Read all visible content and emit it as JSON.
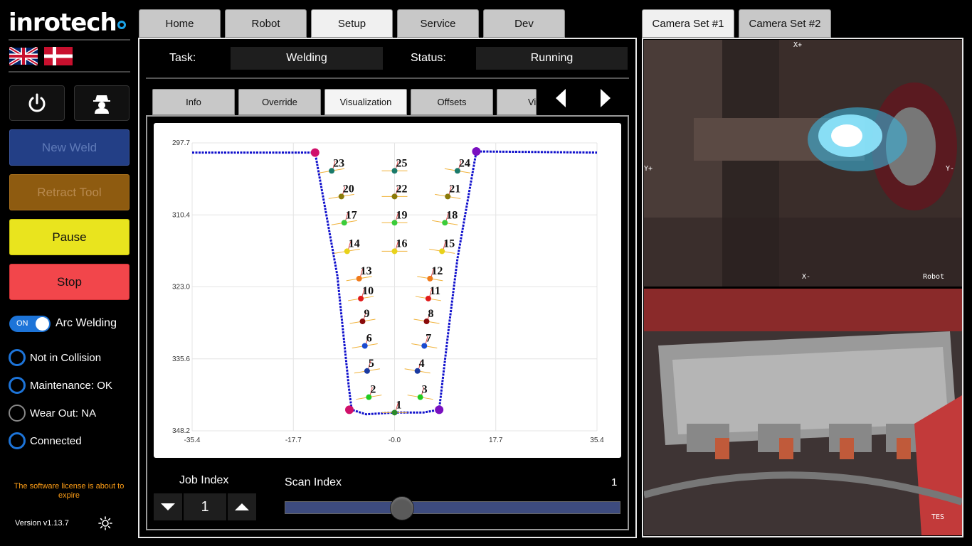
{
  "brand": {
    "name": "inrotech"
  },
  "sidebar": {
    "buttons": {
      "new_weld": "New Weld",
      "retract_tool": "Retract Tool",
      "pause": "Pause",
      "stop": "Stop"
    },
    "arc_toggle": {
      "state": "ON",
      "label": "Arc Welding"
    },
    "statuses": [
      {
        "label": "Not in Collision",
        "indicator": "blue-ring"
      },
      {
        "label": "Maintenance: OK",
        "indicator": "blue-ring"
      },
      {
        "label": "Wear Out: NA",
        "indicator": "grey-ring"
      },
      {
        "label": "Connected",
        "indicator": "blue-ring"
      }
    ],
    "license_notice": "The software license is about to expire",
    "version": "Version v1.13.7",
    "icons": [
      "uk-flag-icon",
      "dk-flag-icon",
      "power-icon",
      "spy-icon",
      "sun-icon"
    ]
  },
  "main_tabs": [
    "Home",
    "Robot",
    "Setup",
    "Service",
    "Dev"
  ],
  "main_active_tab": "Setup",
  "task": {
    "label": "Task:",
    "value": "Welding"
  },
  "status": {
    "label": "Status:",
    "value": "Running"
  },
  "sub_tabs": [
    "Info",
    "Override",
    "Visualization",
    "Offsets",
    "Vi"
  ],
  "sub_active_tab": "Visualization",
  "job_index": {
    "label": "Job Index",
    "value": "1"
  },
  "scan_index": {
    "label": "Scan Index",
    "value": "1",
    "slider_fraction": 0.35
  },
  "camera_tabs": [
    "Camera Set #1",
    "Camera Set #2"
  ],
  "camera_active_tab": "Camera Set #1",
  "camera_overlays": {
    "top": {
      "x_plus": "X+",
      "x_minus": "X-",
      "y_plus": "Y+",
      "y_minus": "Y-",
      "robot": "Robot"
    },
    "bottom": {
      "tes": "TES"
    }
  },
  "colors": {
    "accent_blue": "#1d74d8",
    "pause_yellow": "#e9e41e",
    "stop_red": "#f2464b",
    "retract_orange": "#8e5b10",
    "newweld_blue": "#233f86",
    "license_orange": "#ff9e16"
  },
  "chart_data": {
    "type": "scatter",
    "x_ticks": [
      "-35.4",
      "-17.7",
      "-0.0",
      "17.7",
      "35.4"
    ],
    "y_ticks": [
      "297.7",
      "310.4",
      "323.0",
      "335.6",
      "348.2"
    ],
    "xlim": [
      -35.4,
      35.4
    ],
    "ylim": [
      297.7,
      348.2
    ],
    "y_inverted": true,
    "grid": true,
    "profile": [
      [
        -35.4,
        299.4
      ],
      [
        -13.9,
        299.4
      ],
      [
        -10.0,
        321.0
      ],
      [
        -8.0,
        340.5
      ],
      [
        -7.5,
        344.5
      ],
      [
        -5.0,
        345.3
      ],
      [
        0.0,
        345.0
      ],
      [
        5.0,
        345.0
      ],
      [
        7.8,
        344.5
      ],
      [
        9.5,
        330.0
      ],
      [
        11.0,
        318.0
      ],
      [
        14.3,
        299.2
      ],
      [
        35.4,
        299.4
      ]
    ],
    "corner_markers": [
      {
        "x": -13.9,
        "y": 299.4,
        "color": "#d0106a"
      },
      {
        "x": 14.3,
        "y": 299.2,
        "color": "#7a10c0"
      },
      {
        "x": -7.9,
        "y": 344.5,
        "color": "#d0106a"
      },
      {
        "x": 7.8,
        "y": 344.5,
        "color": "#7a10c0"
      }
    ],
    "points": [
      {
        "label": "1",
        "x": 0.0,
        "y": 345.0,
        "color": "#2a8a2a"
      },
      {
        "label": "2",
        "x": -4.5,
        "y": 342.3,
        "color": "#20cc20"
      },
      {
        "label": "3",
        "x": 4.5,
        "y": 342.3,
        "color": "#20cc20"
      },
      {
        "label": "4",
        "x": 4.0,
        "y": 337.7,
        "color": "#1a3aa0"
      },
      {
        "label": "5",
        "x": -4.8,
        "y": 337.7,
        "color": "#1a3aa0"
      },
      {
        "label": "6",
        "x": -5.2,
        "y": 333.3,
        "color": "#1a4ad0"
      },
      {
        "label": "7",
        "x": 5.2,
        "y": 333.3,
        "color": "#1a4ad0"
      },
      {
        "label": "8",
        "x": 5.6,
        "y": 329.0,
        "color": "#8a0a0a"
      },
      {
        "label": "9",
        "x": -5.6,
        "y": 329.0,
        "color": "#8a0a0a"
      },
      {
        "label": "10",
        "x": -5.9,
        "y": 325.0,
        "color": "#e01a1a"
      },
      {
        "label": "11",
        "x": 5.9,
        "y": 325.0,
        "color": "#e01a1a"
      },
      {
        "label": "12",
        "x": 6.2,
        "y": 321.5,
        "color": "#f07a1a"
      },
      {
        "label": "13",
        "x": -6.2,
        "y": 321.5,
        "color": "#f07a1a"
      },
      {
        "label": "14",
        "x": -8.3,
        "y": 316.7,
        "color": "#e8d21a"
      },
      {
        "label": "15",
        "x": 8.3,
        "y": 316.7,
        "color": "#e8d21a"
      },
      {
        "label": "16",
        "x": 0.0,
        "y": 316.7,
        "color": "#e8d21a"
      },
      {
        "label": "17",
        "x": -8.8,
        "y": 311.7,
        "color": "#3acc3a"
      },
      {
        "label": "18",
        "x": 8.8,
        "y": 311.7,
        "color": "#3acc3a"
      },
      {
        "label": "19",
        "x": 0.0,
        "y": 311.7,
        "color": "#3acc3a"
      },
      {
        "label": "20",
        "x": -9.3,
        "y": 307.1,
        "color": "#8a7a0a"
      },
      {
        "label": "21",
        "x": 9.3,
        "y": 307.1,
        "color": "#8a7a0a"
      },
      {
        "label": "22",
        "x": 0.0,
        "y": 307.1,
        "color": "#8a7a0a"
      },
      {
        "label": "23",
        "x": -11.0,
        "y": 302.6,
        "color": "#1a7a6a"
      },
      {
        "label": "24",
        "x": 11.0,
        "y": 302.6,
        "color": "#1a7a6a"
      },
      {
        "label": "25",
        "x": 0.0,
        "y": 302.6,
        "color": "#1a7a6a"
      }
    ]
  }
}
